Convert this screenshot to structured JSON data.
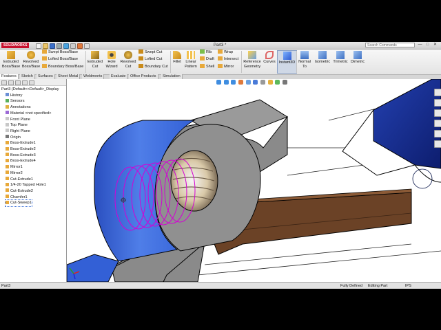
{
  "titlebar": {
    "logo": "SOLIDWORKS",
    "document_title": "Part3 *",
    "search_placeholder": "Search Commands",
    "controls": [
      "—",
      "□",
      "✕"
    ]
  },
  "ribbon": {
    "features": {
      "extruded_boss": "Extruded Boss/Base",
      "revolved_boss": "Revolved Boss/Base",
      "swept_boss": "Swept Boss/Base",
      "lofted_boss": "Lofted Boss/Base",
      "boundary_boss": "Boundary Boss/Base",
      "extruded_cut": "Extruded Cut",
      "hole_wizard": "Hole Wizard",
      "revolved_cut": "Revolved Cut",
      "swept_cut": "Swept Cut",
      "lofted_cut": "Lofted Cut",
      "boundary_cut": "Boundary Cut",
      "fillet": "Fillet",
      "linear_pattern": "Linear Pattern",
      "rib": "Rib",
      "draft": "Draft",
      "shell": "Shell",
      "wrap": "Wrap",
      "intersect": "Intersect",
      "mirror": "Mirror",
      "reference_geometry": "Reference Geometry",
      "curves": "Curves",
      "instant3d": "Instant3D",
      "normal_to": "Normal To",
      "isometric": "Isometric",
      "trimetric": "Trimetric",
      "dimetric": "Dimetric"
    }
  },
  "tabs": [
    "Features",
    "Sketch",
    "Surfaces",
    "Sheet Metal",
    "Weldments",
    "Evaluate",
    "Office Products",
    "Simulation"
  ],
  "active_tab": "Features",
  "feature_tree": {
    "root": "Part3  (Default<<Default>_Display",
    "items": [
      "History",
      "Sensors",
      "Annotations",
      "Material <not specified>",
      "Front Plane",
      "Top Plane",
      "Right Plane",
      "Origin",
      "Boss-Extrude1",
      "Boss-Extrude2",
      "Boss-Extrude3",
      "Boss-Extrude4",
      "Mirror1",
      "Mirror2",
      "Cut-Extrude1",
      "1/4-20 Tapped Hole1",
      "Cut-Extrude2",
      "Chamfer1",
      "Cut-Sweep1"
    ],
    "selected": "Cut-Sweep1"
  },
  "statusbar": {
    "left": "Part3",
    "state": "Fully Defined",
    "mode": "Editing Part",
    "units": "IPS"
  },
  "colors": {
    "accent_blue": "#2f5bd1",
    "body_gray": "#8a8a8a",
    "thread_magenta": "#d400d4",
    "brown_bar": "#6b4226",
    "navy_block": "#12237a",
    "logo_red": "#c8102e"
  }
}
